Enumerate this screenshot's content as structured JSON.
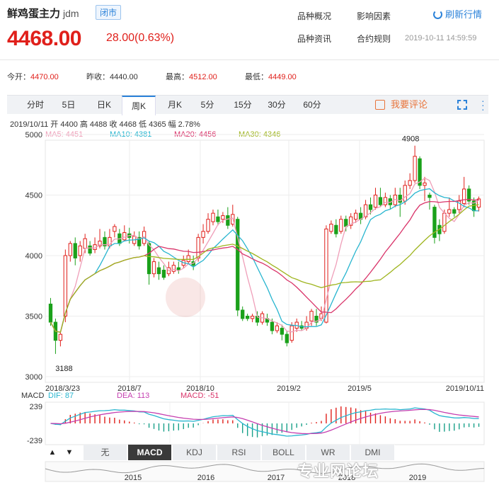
{
  "header": {
    "name": "鲜鸡蛋主力",
    "code": "jdm",
    "status": "闭市",
    "price": "4468.00",
    "change": "28.00(0.63%)",
    "links": [
      "品种概况",
      "影响因素",
      "品种资讯",
      "合约规则"
    ],
    "refresh_label": "刷新行情",
    "datetime": "2019-10-11 14:59:59"
  },
  "stats": [
    {
      "label": "今开：",
      "value": "4470.00",
      "color": "red"
    },
    {
      "label": "昨收：",
      "value": "4440.00",
      "color": "neutral"
    },
    {
      "label": "最高：",
      "value": "4512.00",
      "color": "red"
    },
    {
      "label": "最低：",
      "value": "4449.00",
      "color": "red"
    }
  ],
  "tabs": [
    "分时",
    "5日",
    "日K",
    "周K",
    "月K",
    "5分",
    "15分",
    "30分",
    "60分"
  ],
  "active_tab": "周K",
  "comment_label": "我要评论",
  "ohlc_line": "2019/10/11  开 4400  高 4488  收 4468  低 4365  幅 2.78%",
  "ma_legend": [
    {
      "label": "MA5: 4451",
      "color": "#ef9fb9"
    },
    {
      "label": "MA10: 4381",
      "color": "#27b5cf"
    },
    {
      "label": "MA20: 4456",
      "color": "#d9346a"
    },
    {
      "label": "MA30: 4346",
      "color": "#9fb51f"
    }
  ],
  "macd_legend": [
    {
      "label": "MACD",
      "color": "#333333"
    },
    {
      "label": "DIF: 87",
      "color": "#27b5cf"
    },
    {
      "label": "DEA: 113",
      "color": "#c53fb0"
    },
    {
      "label": "MACD: -51",
      "color": "#d9346a"
    }
  ],
  "indicator_buttons": [
    "无",
    "MACD",
    "KDJ",
    "RSI",
    "BOLL",
    "WR",
    "DMI"
  ],
  "active_indicator": "MACD",
  "nav_arrows": [
    "▲",
    "▼"
  ],
  "watermark_overlay": "专业网论坛",
  "chart_data": {
    "type": "candlestick",
    "y_ticks": [
      "5000",
      "4500",
      "4000",
      "3500",
      "3000"
    ],
    "ylim": [
      3000,
      5000
    ],
    "x_tick_labels": [
      "2018/3/23",
      "2018/7",
      "2018/10",
      "2019/2",
      "2019/5",
      "2019/10/11"
    ],
    "annotations": {
      "high": "4908",
      "low": "3188"
    },
    "macd_ticks": [
      "239",
      "-239"
    ],
    "macd_ylim": [
      -239,
      239
    ],
    "nav_years": [
      "2015",
      "2016",
      "2017",
      "2018",
      "2019"
    ],
    "candles": [
      {
        "o": 3600,
        "c": 3450,
        "h": 3650,
        "l": 3420
      },
      {
        "o": 3450,
        "c": 3300,
        "h": 3480,
        "l": 3188
      },
      {
        "o": 3300,
        "c": 3350,
        "h": 3380,
        "l": 3250
      },
      {
        "o": 3500,
        "c": 4000,
        "h": 4050,
        "l": 3450
      },
      {
        "o": 4000,
        "c": 4100,
        "h": 4120,
        "l": 3950
      },
      {
        "o": 4100,
        "c": 3980,
        "h": 4150,
        "l": 3920
      },
      {
        "o": 4000,
        "c": 4080,
        "h": 4120,
        "l": 3950
      },
      {
        "o": 4060,
        "c": 4140,
        "h": 4180,
        "l": 4020
      },
      {
        "o": 4080,
        "c": 4020,
        "h": 4120,
        "l": 4000
      },
      {
        "o": 4050,
        "c": 4090,
        "h": 4150,
        "l": 4020
      },
      {
        "o": 4080,
        "c": 4120,
        "h": 4220,
        "l": 4060
      },
      {
        "o": 4150,
        "c": 4080,
        "h": 4200,
        "l": 4050
      },
      {
        "o": 4080,
        "c": 4150,
        "h": 4220,
        "l": 4060
      },
      {
        "o": 4200,
        "c": 4240,
        "h": 4260,
        "l": 4150
      },
      {
        "o": 4180,
        "c": 4100,
        "h": 4220,
        "l": 4080
      },
      {
        "o": 4130,
        "c": 4190,
        "h": 4250,
        "l": 4120
      },
      {
        "o": 4180,
        "c": 4150,
        "h": 4230,
        "l": 4100
      },
      {
        "o": 4100,
        "c": 4160,
        "h": 4200,
        "l": 4080
      },
      {
        "o": 4150,
        "c": 4080,
        "h": 4200,
        "l": 4050
      },
      {
        "o": 4100,
        "c": 4200,
        "h": 4240,
        "l": 4080
      },
      {
        "o": 4100,
        "c": 3850,
        "h": 4120,
        "l": 3760
      },
      {
        "o": 3850,
        "c": 3950,
        "h": 3980,
        "l": 3820
      },
      {
        "o": 3900,
        "c": 3850,
        "h": 3950,
        "l": 3800
      },
      {
        "o": 3880,
        "c": 3820,
        "h": 3920,
        "l": 3800
      },
      {
        "o": 3850,
        "c": 3900,
        "h": 3950,
        "l": 3830
      },
      {
        "o": 3870,
        "c": 3920,
        "h": 3950,
        "l": 3850
      },
      {
        "o": 3900,
        "c": 3880,
        "h": 3950,
        "l": 3850
      },
      {
        "o": 3920,
        "c": 3960,
        "h": 4000,
        "l": 3900
      },
      {
        "o": 3950,
        "c": 4000,
        "h": 4050,
        "l": 3930
      },
      {
        "o": 3950,
        "c": 3920,
        "h": 4000,
        "l": 3880
      },
      {
        "o": 3980,
        "c": 4150,
        "h": 4180,
        "l": 3950
      },
      {
        "o": 4150,
        "c": 4200,
        "h": 4260,
        "l": 4100
      },
      {
        "o": 4200,
        "c": 4300,
        "h": 4350,
        "l": 4180
      },
      {
        "o": 4280,
        "c": 4350,
        "h": 4380,
        "l": 4250
      },
      {
        "o": 4320,
        "c": 4280,
        "h": 4380,
        "l": 4250
      },
      {
        "o": 4300,
        "c": 4330,
        "h": 4360,
        "l": 4270
      },
      {
        "o": 4330,
        "c": 4250,
        "h": 4400,
        "l": 4220
      },
      {
        "o": 4260,
        "c": 4340,
        "h": 4420,
        "l": 4240
      },
      {
        "o": 4300,
        "c": 3550,
        "h": 4320,
        "l": 3500
      },
      {
        "o": 3550,
        "c": 3480,
        "h": 3580,
        "l": 3460
      },
      {
        "o": 3500,
        "c": 3480,
        "h": 3520,
        "l": 3460
      },
      {
        "o": 3480,
        "c": 3500,
        "h": 3520,
        "l": 3450
      },
      {
        "o": 3500,
        "c": 3450,
        "h": 3540,
        "l": 3420
      },
      {
        "o": 3450,
        "c": 3520,
        "h": 3540,
        "l": 3430
      },
      {
        "o": 3480,
        "c": 3450,
        "h": 3520,
        "l": 3420
      },
      {
        "o": 3450,
        "c": 3380,
        "h": 3480,
        "l": 3350
      },
      {
        "o": 3380,
        "c": 3420,
        "h": 3450,
        "l": 3360
      },
      {
        "o": 3400,
        "c": 3350,
        "h": 3430,
        "l": 3300
      },
      {
        "o": 3350,
        "c": 3280,
        "h": 3380,
        "l": 3250
      },
      {
        "o": 3300,
        "c": 3420,
        "h": 3450,
        "l": 3280
      },
      {
        "o": 3400,
        "c": 3450,
        "h": 3480,
        "l": 3370
      },
      {
        "o": 3420,
        "c": 3400,
        "h": 3460,
        "l": 3380
      },
      {
        "o": 3400,
        "c": 3450,
        "h": 3500,
        "l": 3380
      },
      {
        "o": 3460,
        "c": 3540,
        "h": 3560,
        "l": 3420
      },
      {
        "o": 3500,
        "c": 3450,
        "h": 3560,
        "l": 3420
      },
      {
        "o": 3480,
        "c": 3520,
        "h": 3580,
        "l": 3460
      },
      {
        "o": 3450,
        "c": 4220,
        "h": 4250,
        "l": 3440
      },
      {
        "o": 4200,
        "c": 4260,
        "h": 4290,
        "l": 4180
      },
      {
        "o": 4250,
        "c": 4180,
        "h": 4300,
        "l": 4150
      },
      {
        "o": 4200,
        "c": 4300,
        "h": 4330,
        "l": 4180
      },
      {
        "o": 4300,
        "c": 4240,
        "h": 4330,
        "l": 4200
      },
      {
        "o": 4250,
        "c": 4320,
        "h": 4350,
        "l": 4220
      },
      {
        "o": 4300,
        "c": 4350,
        "h": 4380,
        "l": 4270
      },
      {
        "o": 4350,
        "c": 4300,
        "h": 4400,
        "l": 4260
      },
      {
        "o": 4320,
        "c": 4420,
        "h": 4460,
        "l": 4300
      },
      {
        "o": 4420,
        "c": 4380,
        "h": 4480,
        "l": 4340
      },
      {
        "o": 4400,
        "c": 4500,
        "h": 4560,
        "l": 4380
      },
      {
        "o": 4480,
        "c": 4420,
        "h": 4560,
        "l": 4400
      },
      {
        "o": 4420,
        "c": 4480,
        "h": 4520,
        "l": 4400
      },
      {
        "o": 4470,
        "c": 4420,
        "h": 4500,
        "l": 4380
      },
      {
        "o": 4420,
        "c": 4500,
        "h": 4560,
        "l": 4400
      },
      {
        "o": 4500,
        "c": 4440,
        "h": 4560,
        "l": 4320
      },
      {
        "o": 4450,
        "c": 4580,
        "h": 4620,
        "l": 4420
      },
      {
        "o": 4580,
        "c": 4620,
        "h": 4680,
        "l": 4550
      },
      {
        "o": 4620,
        "c": 4820,
        "h": 4908,
        "l": 4600
      },
      {
        "o": 4800,
        "c": 4580,
        "h": 4820,
        "l": 4550
      },
      {
        "o": 4580,
        "c": 4600,
        "h": 4650,
        "l": 4450
      },
      {
        "o": 4500,
        "c": 4480,
        "h": 4520,
        "l": 4380
      },
      {
        "o": 4400,
        "c": 4150,
        "h": 4420,
        "l": 4100
      },
      {
        "o": 4250,
        "c": 4180,
        "h": 4300,
        "l": 4120
      },
      {
        "o": 4200,
        "c": 4350,
        "h": 4380,
        "l": 4180
      },
      {
        "o": 4350,
        "c": 4380,
        "h": 4480,
        "l": 4320
      },
      {
        "o": 4380,
        "c": 4350,
        "h": 4400,
        "l": 4320
      },
      {
        "o": 4380,
        "c": 4450,
        "h": 4500,
        "l": 4350
      },
      {
        "o": 4430,
        "c": 4550,
        "h": 4650,
        "l": 4400
      },
      {
        "o": 4550,
        "c": 4450,
        "h": 4580,
        "l": 4420
      },
      {
        "o": 4450,
        "c": 4370,
        "h": 4480,
        "l": 4320
      },
      {
        "o": 4400,
        "c": 4468,
        "h": 4488,
        "l": 4365
      }
    ]
  }
}
